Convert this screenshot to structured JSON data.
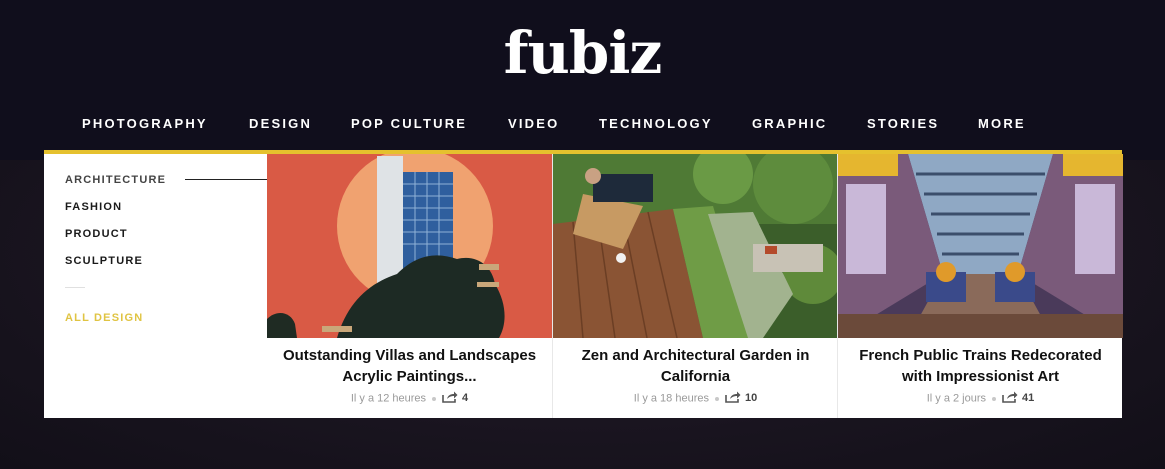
{
  "logo": "fubiz",
  "nav": [
    {
      "label": "PHOTOGRAPHY"
    },
    {
      "label": "DESIGN"
    },
    {
      "label": "POP CULTURE"
    },
    {
      "label": "VIDEO"
    },
    {
      "label": "TECHNOLOGY"
    },
    {
      "label": "GRAPHIC"
    },
    {
      "label": "STORIES"
    },
    {
      "label": "MORE"
    }
  ],
  "submenu": {
    "items": [
      {
        "label": "ARCHITECTURE"
      },
      {
        "label": "FASHION"
      },
      {
        "label": "PRODUCT"
      },
      {
        "label": "SCULPTURE"
      }
    ],
    "all_label": "ALL DESIGN"
  },
  "colors": {
    "accent": "#e5c12e",
    "all_link": "#e0c443"
  },
  "cards": [
    {
      "title": "Outstanding Villas and Landscapes Acrylic Paintings...",
      "time": "Il y a 12 heures",
      "shares": "4"
    },
    {
      "title": "Zen and Architectural Garden in California",
      "time": "Il y a 18 heures",
      "shares": "10"
    },
    {
      "title": "French Public Trains Redecorated with Impressionist Art",
      "time": "Il y a 2 jours",
      "shares": "41"
    }
  ]
}
